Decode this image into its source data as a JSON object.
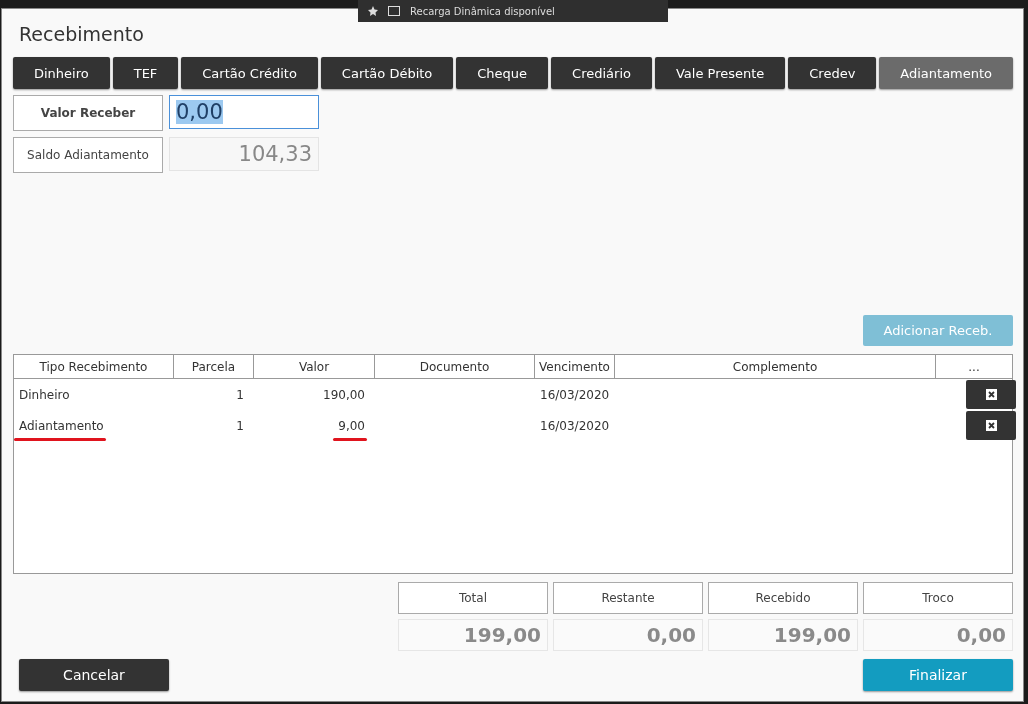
{
  "background_toolbar": {
    "text": "Recarga Dinâmica disponível"
  },
  "dialog": {
    "title": "Recebimento"
  },
  "tabs": [
    {
      "label": "Dinheiro",
      "selected": false
    },
    {
      "label": "TEF",
      "selected": false
    },
    {
      "label": "Cartão Crédito",
      "selected": false
    },
    {
      "label": "Cartão Débito",
      "selected": false
    },
    {
      "label": "Cheque",
      "selected": false
    },
    {
      "label": "Crediário",
      "selected": false
    },
    {
      "label": "Vale Presente",
      "selected": false
    },
    {
      "label": "Credev",
      "selected": false
    },
    {
      "label": "Adiantamento",
      "selected": true
    }
  ],
  "fields": [
    {
      "label": "Valor Receber",
      "value": "0,00",
      "kind": "input"
    },
    {
      "label": "Saldo Adiantamento",
      "value": "104,33",
      "kind": "readonly"
    }
  ],
  "add_button": {
    "label": "Adicionar Receb.",
    "disabled": true
  },
  "table": {
    "columns": [
      "Tipo Recebimento",
      "Parcela",
      "Valor",
      "Documento",
      "Vencimento",
      "Complemento",
      "..."
    ],
    "rows": [
      {
        "tipo": "Dinheiro",
        "parcela": "1",
        "valor": "190,00",
        "vencimento": "16/03/2020",
        "marked": false
      },
      {
        "tipo": "Adiantamento",
        "parcela": "1",
        "valor": "9,00",
        "vencimento": "16/03/2020",
        "marked": true
      }
    ]
  },
  "totals": [
    {
      "label": "Total",
      "value": "199,00"
    },
    {
      "label": "Restante",
      "value": "0,00"
    },
    {
      "label": "Recebido",
      "value": "199,00"
    },
    {
      "label": "Troco",
      "value": "0,00"
    }
  ],
  "buttons": {
    "cancel": "Cancelar",
    "finish": "Finalizar"
  }
}
